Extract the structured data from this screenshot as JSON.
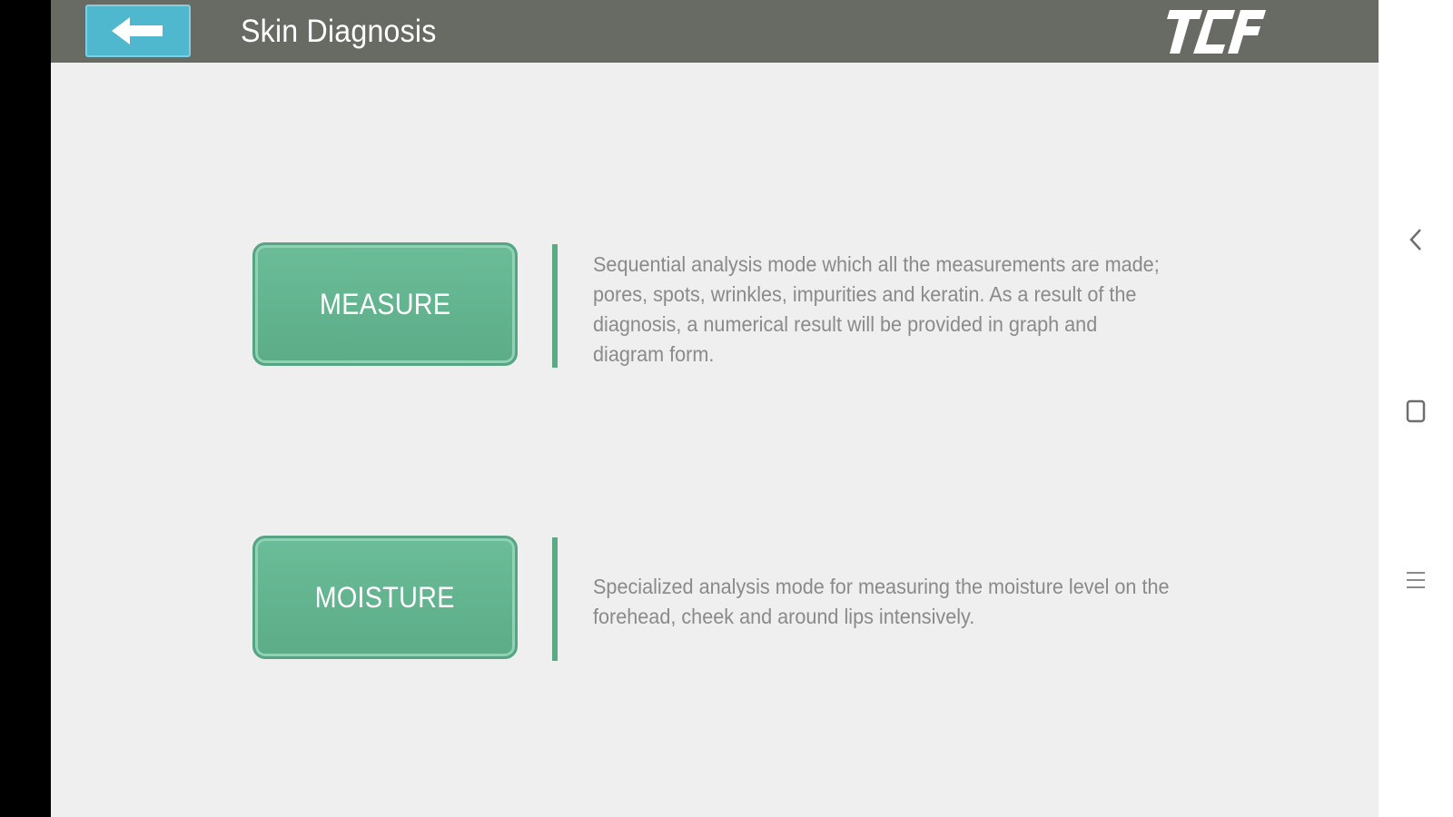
{
  "header": {
    "title": "Skin Diagnosis",
    "back_icon": "arrow-left-icon",
    "logo_icon": "tcf-logo",
    "background": "#686a64",
    "back_color": "#4fb8cf"
  },
  "modes": [
    {
      "label": "MEASURE",
      "description": "Sequential analysis mode which all the measurements are made; pores, spots, wrinkles, impurities and keratin. As a result of the diagnosis, a numerical result will be provided in graph and diagram form."
    },
    {
      "label": "MOISTURE",
      "description": "Specialized analysis mode for measuring the moisture level on the forehead, cheek and around lips intensively."
    }
  ],
  "navigation": {
    "back_icon": "chevron-left-icon",
    "home_icon": "square-icon",
    "menu_icon": "menu-icon"
  },
  "colors": {
    "accent_green": "#5aaa86",
    "text_gray": "#8a8a8a",
    "background": "#efefef"
  }
}
